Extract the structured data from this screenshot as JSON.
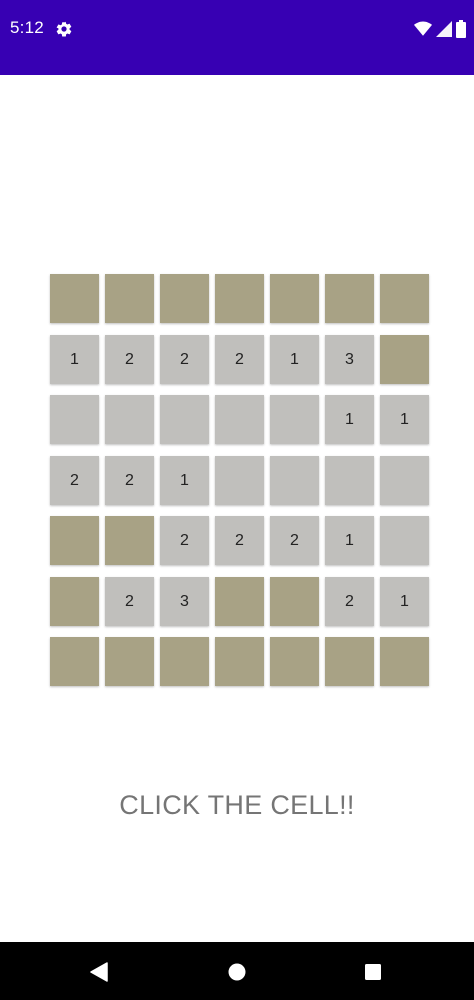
{
  "status_bar": {
    "time": "5:12",
    "icons": [
      "settings-icon",
      "wifi-icon",
      "signal-icon",
      "battery-icon"
    ],
    "color": "#3700b3"
  },
  "board": {
    "rows": 7,
    "cols": 7,
    "covered_color": "#a8a285",
    "revealed_color": "#c0bfbc",
    "cells": [
      [
        {
          "s": "covered",
          "v": ""
        },
        {
          "s": "covered",
          "v": ""
        },
        {
          "s": "covered",
          "v": ""
        },
        {
          "s": "covered",
          "v": ""
        },
        {
          "s": "covered",
          "v": ""
        },
        {
          "s": "covered",
          "v": ""
        },
        {
          "s": "covered",
          "v": ""
        }
      ],
      [
        {
          "s": "revealed",
          "v": "1"
        },
        {
          "s": "revealed",
          "v": "2"
        },
        {
          "s": "revealed",
          "v": "2"
        },
        {
          "s": "revealed",
          "v": "2"
        },
        {
          "s": "revealed",
          "v": "1"
        },
        {
          "s": "revealed",
          "v": "3"
        },
        {
          "s": "covered",
          "v": ""
        }
      ],
      [
        {
          "s": "revealed",
          "v": ""
        },
        {
          "s": "revealed",
          "v": ""
        },
        {
          "s": "revealed",
          "v": ""
        },
        {
          "s": "revealed",
          "v": ""
        },
        {
          "s": "revealed",
          "v": ""
        },
        {
          "s": "revealed",
          "v": "1"
        },
        {
          "s": "revealed",
          "v": "1"
        }
      ],
      [
        {
          "s": "revealed",
          "v": "2"
        },
        {
          "s": "revealed",
          "v": "2"
        },
        {
          "s": "revealed",
          "v": "1"
        },
        {
          "s": "revealed",
          "v": ""
        },
        {
          "s": "revealed",
          "v": ""
        },
        {
          "s": "revealed",
          "v": ""
        },
        {
          "s": "revealed",
          "v": ""
        }
      ],
      [
        {
          "s": "covered",
          "v": ""
        },
        {
          "s": "covered",
          "v": ""
        },
        {
          "s": "revealed",
          "v": "2"
        },
        {
          "s": "revealed",
          "v": "2"
        },
        {
          "s": "revealed",
          "v": "2"
        },
        {
          "s": "revealed",
          "v": "1"
        },
        {
          "s": "revealed",
          "v": ""
        }
      ],
      [
        {
          "s": "covered",
          "v": ""
        },
        {
          "s": "revealed",
          "v": "2"
        },
        {
          "s": "revealed",
          "v": "3"
        },
        {
          "s": "covered",
          "v": ""
        },
        {
          "s": "covered",
          "v": ""
        },
        {
          "s": "revealed",
          "v": "2"
        },
        {
          "s": "revealed",
          "v": "1"
        }
      ],
      [
        {
          "s": "covered",
          "v": ""
        },
        {
          "s": "covered",
          "v": ""
        },
        {
          "s": "covered",
          "v": ""
        },
        {
          "s": "covered",
          "v": ""
        },
        {
          "s": "covered",
          "v": ""
        },
        {
          "s": "covered",
          "v": ""
        },
        {
          "s": "covered",
          "v": ""
        }
      ]
    ]
  },
  "message": "CLICK THE CELL!!",
  "nav_bar": {
    "icons": [
      "back-icon",
      "home-icon",
      "recents-icon"
    ]
  }
}
